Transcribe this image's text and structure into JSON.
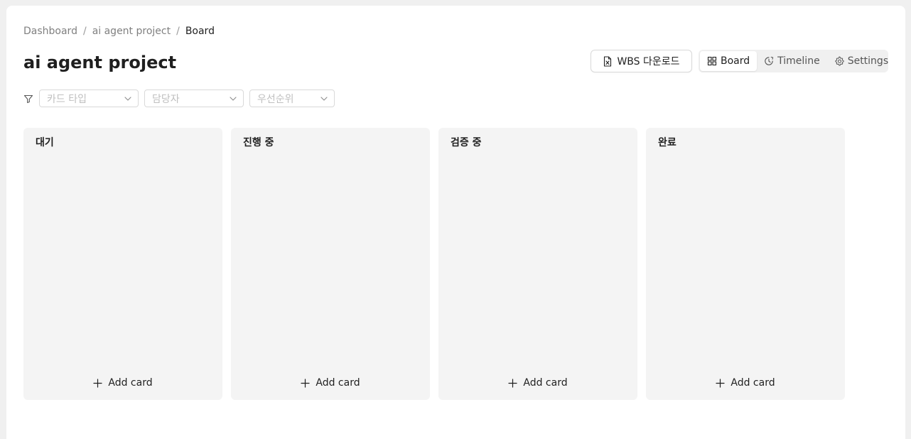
{
  "breadcrumb": {
    "items": [
      "Dashboard",
      "ai agent project",
      "Board"
    ],
    "separator": "/"
  },
  "page": {
    "title": "ai agent project"
  },
  "toolbar": {
    "wbs_download_label": "WBS 다운로드",
    "wbs_icon": "excel-file-icon"
  },
  "views": {
    "tabs": [
      {
        "label": "Board",
        "icon": "board-grid-icon",
        "active": true
      },
      {
        "label": "Timeline",
        "icon": "clock-icon",
        "active": false
      },
      {
        "label": "Settings",
        "icon": "gear-icon",
        "active": false
      }
    ]
  },
  "filters": {
    "icon": "filter-icon",
    "items": [
      {
        "placeholder": "카드 타입"
      },
      {
        "placeholder": "담당자"
      },
      {
        "placeholder": "우선순위"
      }
    ]
  },
  "board": {
    "add_card_label": "Add card",
    "columns": [
      {
        "title": "대기"
      },
      {
        "title": "진행 중"
      },
      {
        "title": "검증 중"
      },
      {
        "title": "완료"
      }
    ]
  },
  "colors": {
    "background": "#f0f0f0",
    "page": "#ffffff",
    "column": "#f4f4f4",
    "border": "#d9d9d9",
    "text": "#1f1f1f",
    "muted": "#808080",
    "placeholder": "#bfbfbf"
  }
}
